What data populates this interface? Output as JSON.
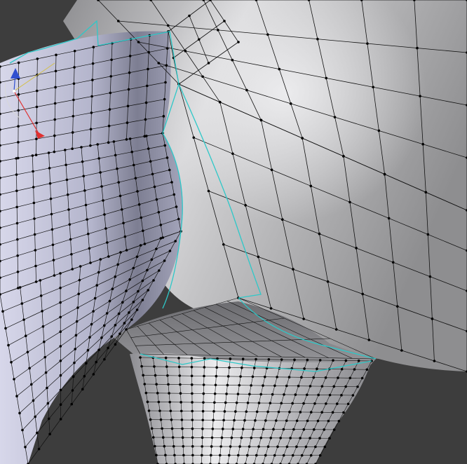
{
  "viewport": {
    "background_color": "#3d3d3d",
    "mesh_color": "#a9a9ad",
    "arm_color": "#a7a8c2",
    "wire_color": "#111111",
    "seam_color": "#2ec8c8"
  },
  "gizmo": {
    "x_axis_color": "#e03030",
    "y_axis_color": "#d4c04a",
    "z_axis_color": "#2f4fd0"
  }
}
